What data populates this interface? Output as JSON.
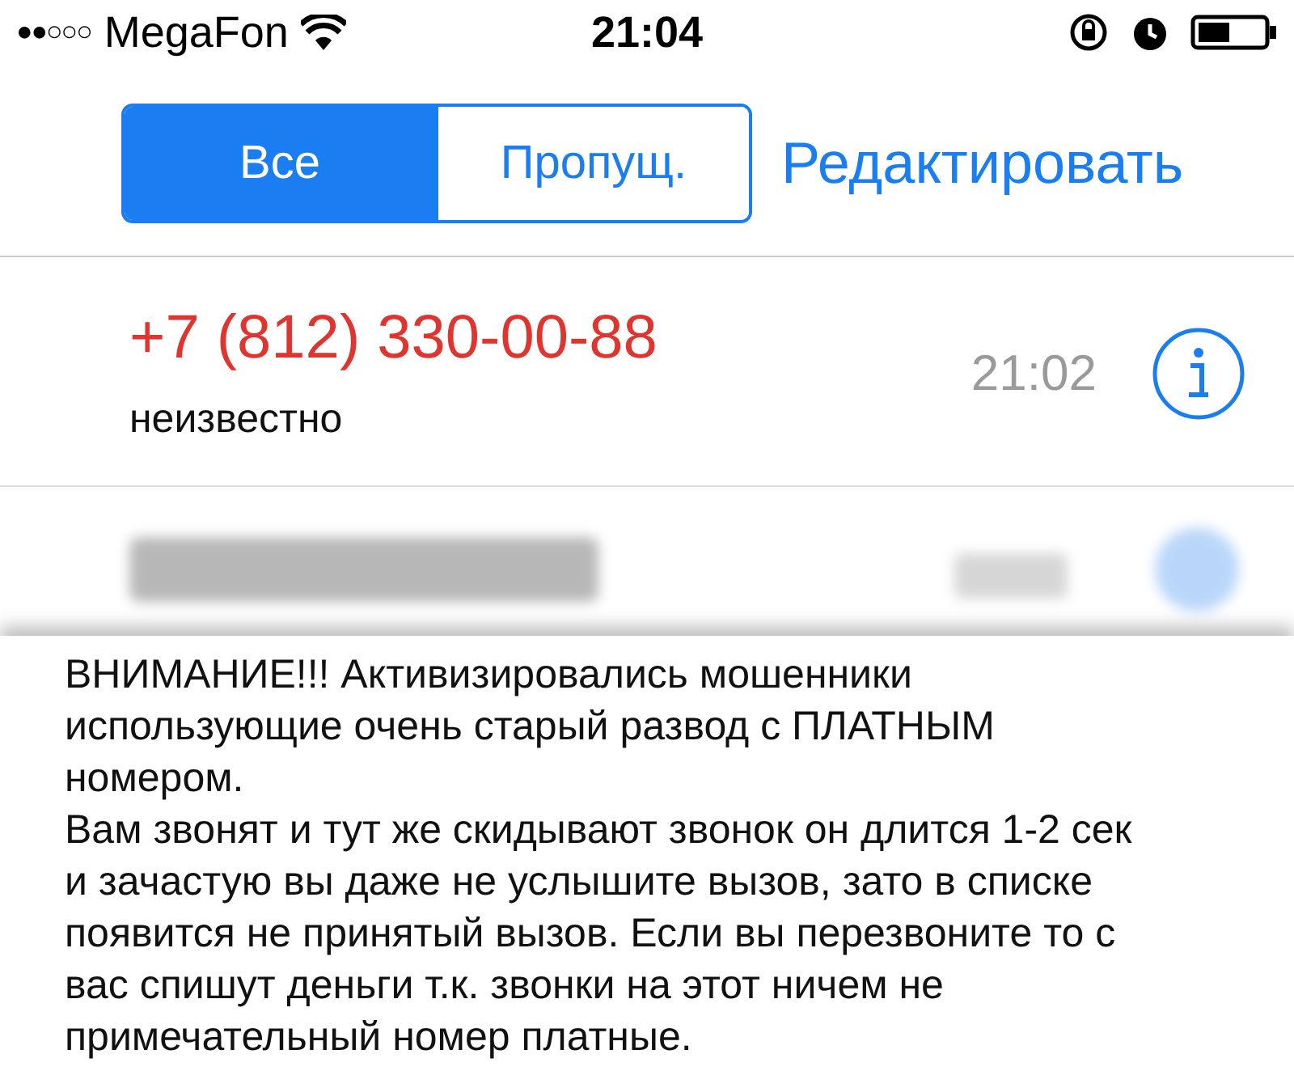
{
  "status_bar": {
    "signal": "●●○○○",
    "carrier": "MegaFon",
    "time": "21:04"
  },
  "segments": [
    {
      "label": "Все",
      "selected": true
    },
    {
      "label": "Пропущ.",
      "selected": false
    }
  ],
  "edit_button": "Редактировать",
  "calls": [
    {
      "number": "+7 (812) 330-00-88",
      "label": "неизвестно",
      "time": "21:02",
      "missed": true
    }
  ],
  "notice": "ВНИМАНИЕ!!! Активизировались мошенники использующие очень старый развод с ПЛАТНЫМ номером.\nВам звонят и тут же скидывают звонок он длится 1-2 сек и зачастую вы даже не услышите вызов, зато в списке появится не принятый вызов. Если вы перезвоните то с вас спишут деньги т.к. звонки на этот ничем не примечательный номер платные."
}
